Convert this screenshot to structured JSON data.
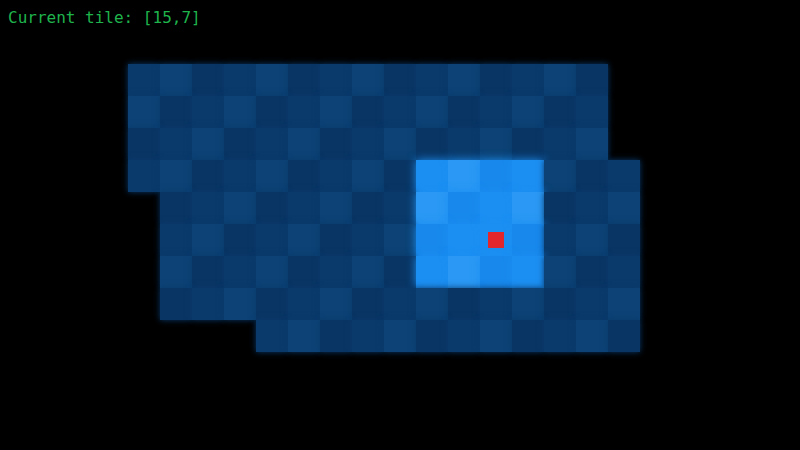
{
  "status": {
    "text": "Current tile: [15,7]"
  },
  "map": {
    "legend": {
      "empty": ".",
      "floor": "#",
      "lit": "L",
      "player": "P"
    },
    "rows": [
      ".........................",
      ".........................",
      "....###############......",
      "....###############......",
      "....###############......",
      "....#########LLLL###.....",
      ".....########LLLL###.....",
      ".....########LLPL###.....",
      ".....########LLLL###.....",
      ".....###############.....",
      "........############.....",
      ".........................",
      ".........................",
      "........................."
    ]
  }
}
